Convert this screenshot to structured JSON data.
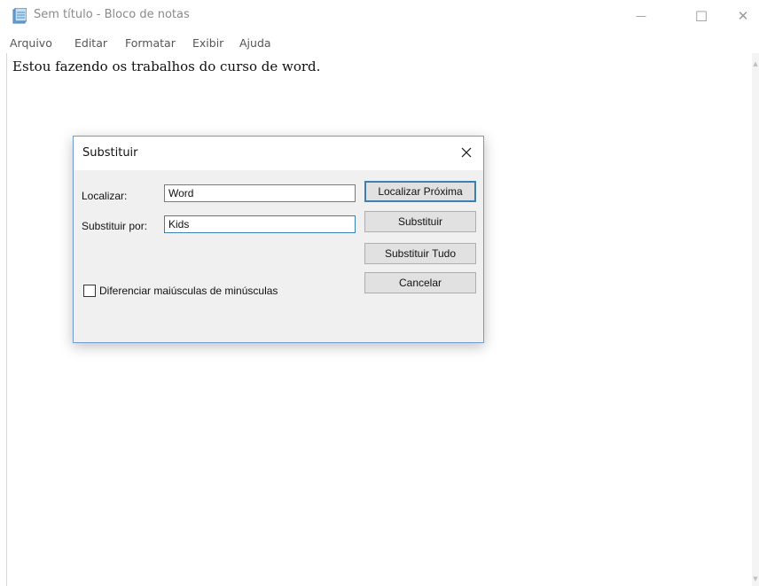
{
  "window": {
    "title": "Sem título - Bloco de notas",
    "minimize": "—",
    "maximize": "☐",
    "close": "✕"
  },
  "menu": [
    "Arquivo",
    "Editar",
    "Formatar",
    "Exibir",
    "Ajuda"
  ],
  "editor": {
    "text": "Estou fazendo os trabalhos do curso de word."
  },
  "dialog": {
    "title": "Substituir",
    "find_label": "Localizar:",
    "find_value": "Word",
    "replace_label": "Substituir por:",
    "replace_value": "Kids",
    "btn_find_next": "Localizar Próxima",
    "btn_replace": "Substituir",
    "btn_replace_all": "Substituir Tudo",
    "btn_cancel": "Cancelar",
    "match_case_label": "Diferenciar maiúsculas de minúsculas",
    "match_case_checked": false
  },
  "colors": {
    "dialog_border": "#6f9bd1",
    "focus_border": "#3c7fb1",
    "dialog_bg": "#f0f0f0"
  }
}
